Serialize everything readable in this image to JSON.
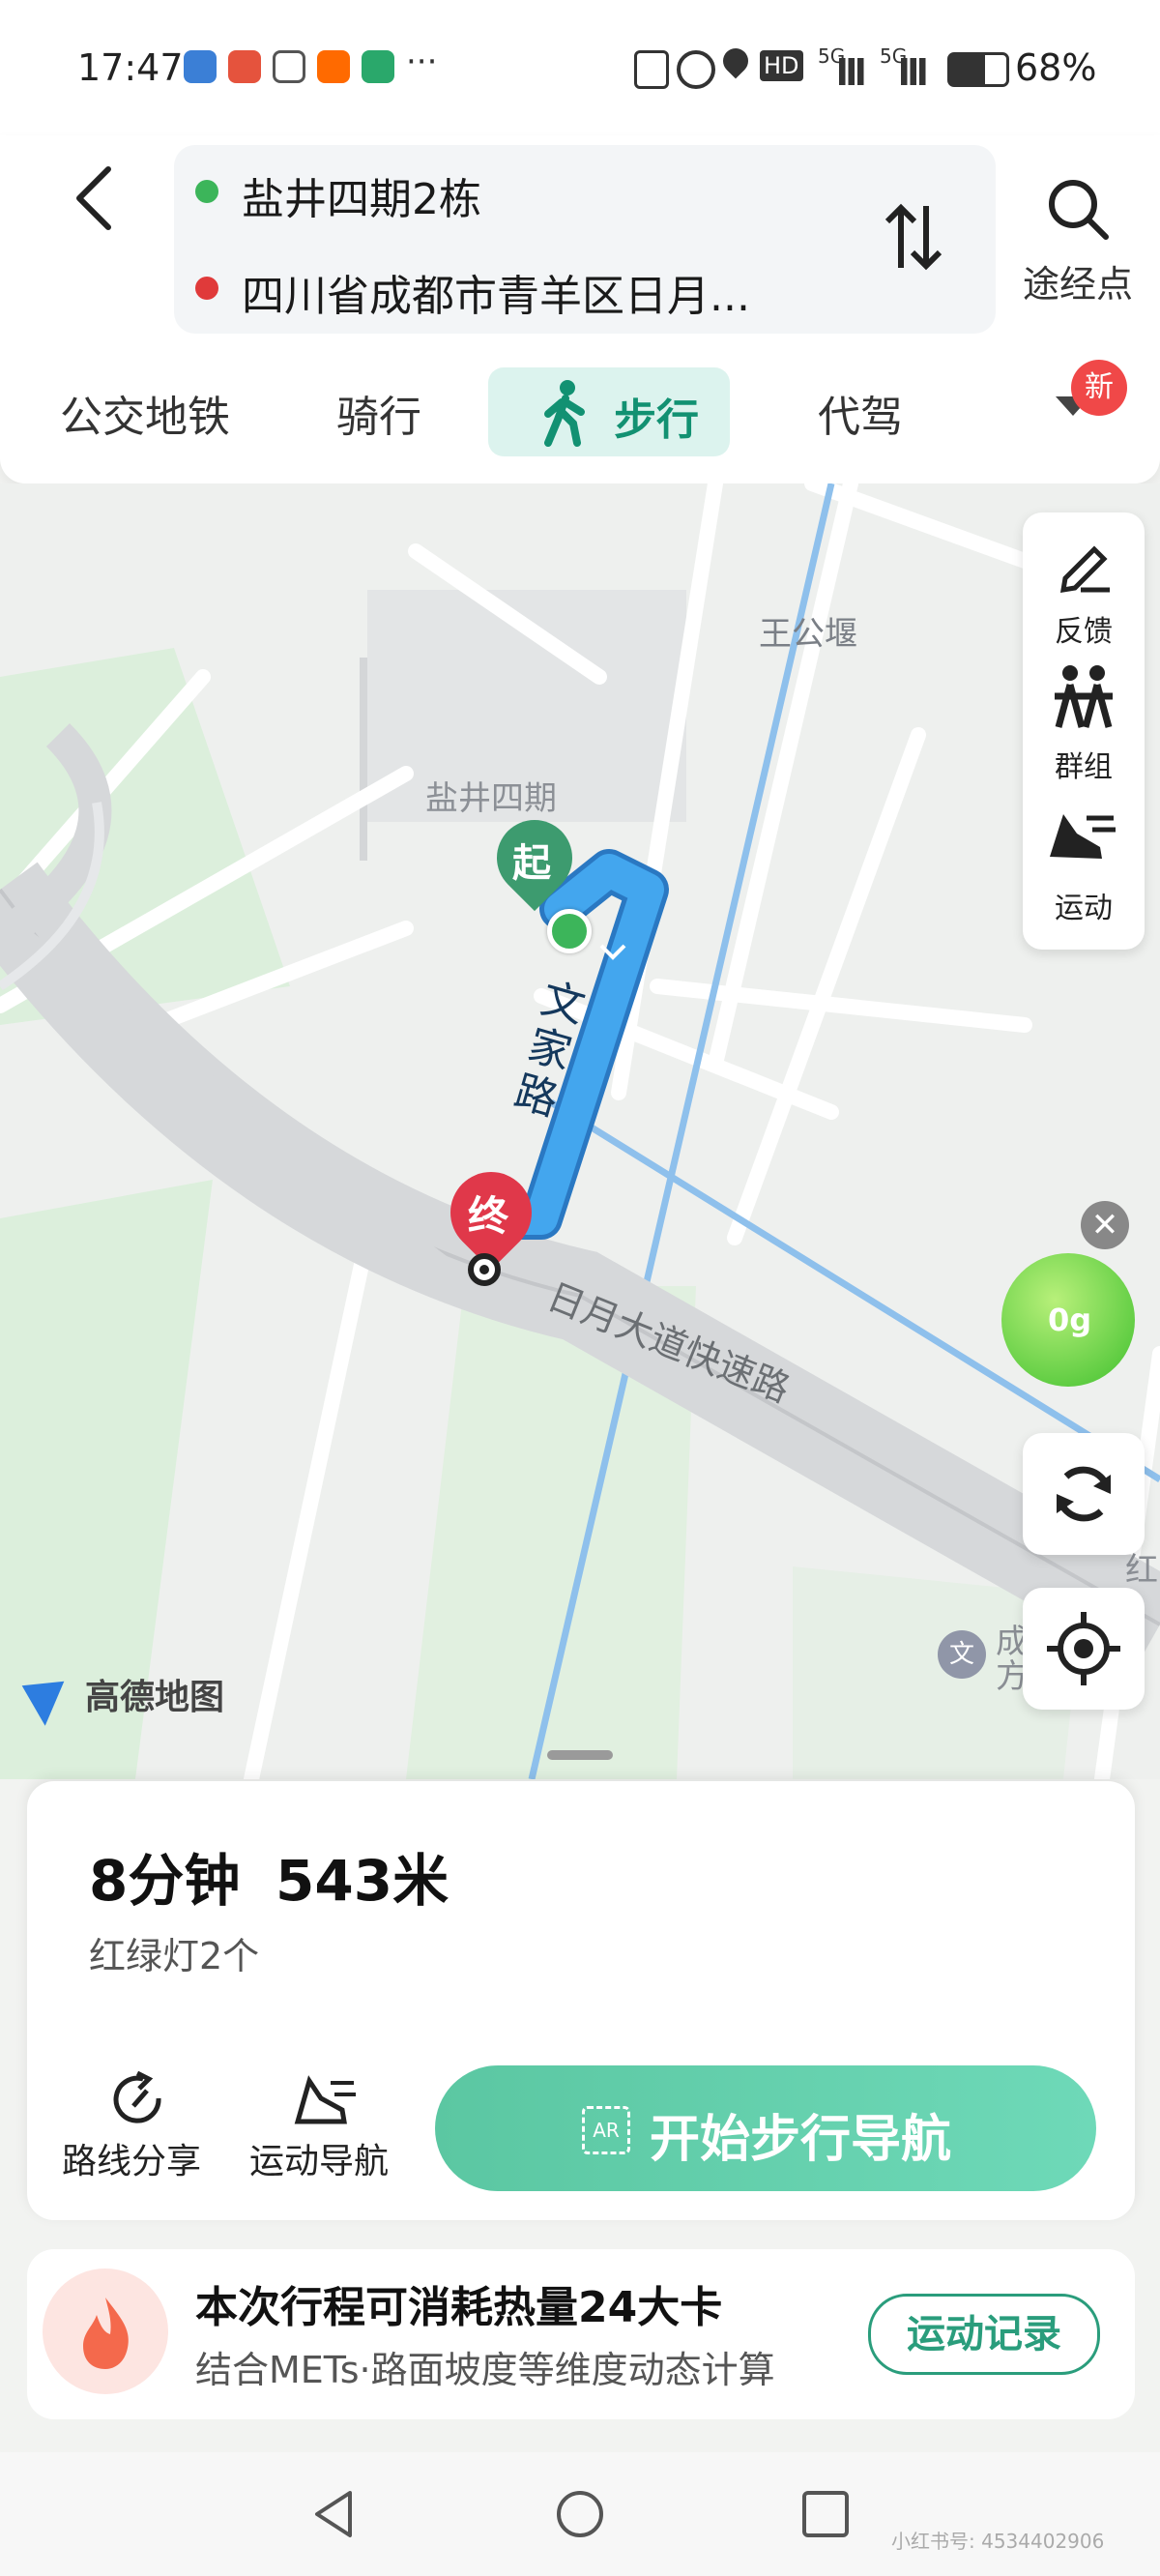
{
  "status_bar": {
    "time": "17:47",
    "dots": "···",
    "battery_percent": "68%",
    "net_a": "HD",
    "net_b": "5G",
    "net_c": "5G"
  },
  "header": {
    "origin": "盐井四期2栋",
    "destination": "四川省成都市青羊区日月...",
    "via_label": "途经点"
  },
  "tabs": {
    "transit": "公交地铁",
    "ride": "骑行",
    "walk": "步行",
    "driver": "代驾",
    "new_badge": "新"
  },
  "map": {
    "place_wang": "王公堰",
    "place_yanjing": "盐井四期",
    "road_wenjia": "文家路",
    "road_riyue": "日月大道快速路",
    "start_marker": "起",
    "end_marker": "终",
    "brand": "高德地图",
    "poi_icon_char": "文",
    "poi_text_1": "成",
    "poi_text_2": "方",
    "edge_text": "红",
    "eco_value": "0g"
  },
  "tools": {
    "feedback": "反馈",
    "group": "群组",
    "sport": "运动"
  },
  "summary": {
    "duration": "8分钟",
    "distance": "543米",
    "traffic_lights": "红绿灯2个",
    "share_route": "路线分享",
    "sport_nav": "运动导航",
    "start_nav": "开始步行导航"
  },
  "calories": {
    "title": "本次行程可消耗热量24大卡",
    "subtitle": "结合METs·路面坡度等维度动态计算",
    "record": "运动记录"
  },
  "watermark": "小红书号: 4534402906",
  "colors": {
    "accent": "#129172",
    "origin_dot": "#3cb55a",
    "destination_dot": "#e03a3a",
    "route": "#3aa3e8"
  }
}
